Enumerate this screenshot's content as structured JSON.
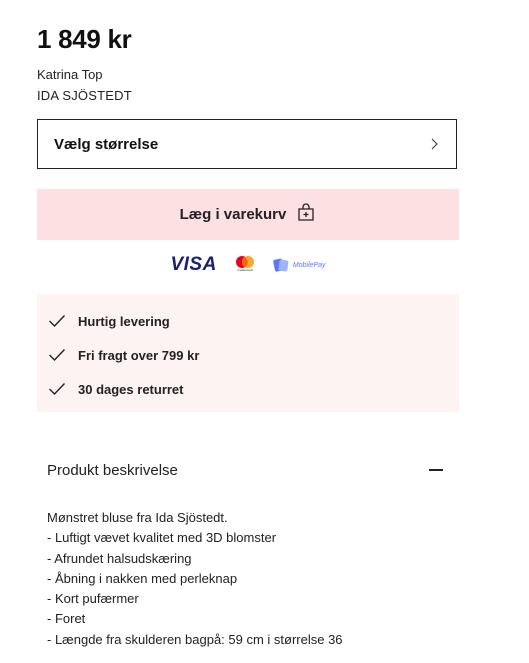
{
  "product": {
    "price": "1 849 kr",
    "name": "Katrina Top",
    "brand": "IDA SJÖSTEDT"
  },
  "size_select": {
    "label": "Vælg størrelse",
    "icon": "chevron-right-icon"
  },
  "cart": {
    "label": "Læg i varekurv",
    "icon": "bag-plus-icon",
    "background": "#fde0e2"
  },
  "payments": {
    "visa": "VISA",
    "mastercard_label": "mastercard",
    "mobilepay_label": "MobilePay"
  },
  "perks": [
    {
      "label": "Hurtig levering",
      "icon": "check-icon"
    },
    {
      "label": "Fri fragt over 799 kr",
      "icon": "check-icon"
    },
    {
      "label": "30 dages returret",
      "icon": "check-icon"
    }
  ],
  "description": {
    "title": "Produkt beskrivelse",
    "toggle_icon": "minus-icon",
    "lines": [
      "Mønstret bluse fra Ida Sjöstedt.",
      "- Luftigt vævet kvalitet med 3D blomster",
      "- Afrundet halsudskæring",
      "- Åbning i nakken med perleknap",
      "- Kort pufærmer",
      "- Foret",
      "- Længde fra skulderen bagpå: 59 cm i størrelse 36"
    ]
  }
}
